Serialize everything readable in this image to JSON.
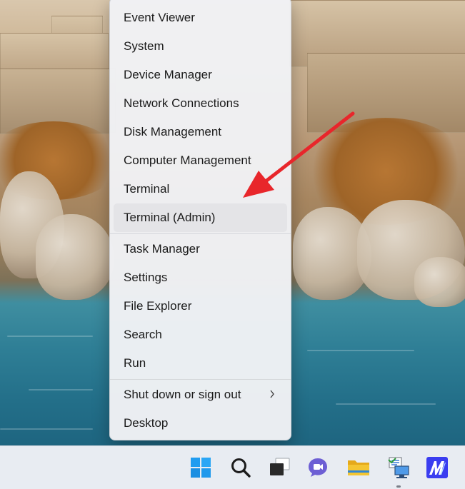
{
  "context_menu": {
    "groups": [
      [
        {
          "label": "Event Viewer"
        },
        {
          "label": "System"
        },
        {
          "label": "Device Manager"
        },
        {
          "label": "Network Connections"
        },
        {
          "label": "Disk Management"
        },
        {
          "label": "Computer Management"
        },
        {
          "label": "Terminal"
        },
        {
          "label": "Terminal (Admin)"
        }
      ],
      [
        {
          "label": "Task Manager"
        },
        {
          "label": "Settings"
        },
        {
          "label": "File Explorer"
        },
        {
          "label": "Search"
        },
        {
          "label": "Run"
        }
      ],
      [
        {
          "label": "Shut down or sign out"
        },
        {
          "label": "Desktop"
        }
      ]
    ],
    "hovered_item": "Terminal (Admin)",
    "submenu_item": "Shut down or sign out"
  },
  "taskbar": {
    "icons": [
      {
        "name": "start-icon"
      },
      {
        "name": "search-icon"
      },
      {
        "name": "task-view-icon"
      },
      {
        "name": "chat-icon"
      },
      {
        "name": "file-explorer-icon"
      },
      {
        "name": "remote-desktop-icon"
      },
      {
        "name": "app-icon"
      }
    ],
    "active_icon": "remote-desktop-icon"
  },
  "colors": {
    "annotation_arrow": "#e8262b",
    "windows_blue": "#1f9cf0",
    "folder_yellow": "#f4c531",
    "chat_purple": "#6d5fd4",
    "app_tile": "#3a3df0"
  }
}
